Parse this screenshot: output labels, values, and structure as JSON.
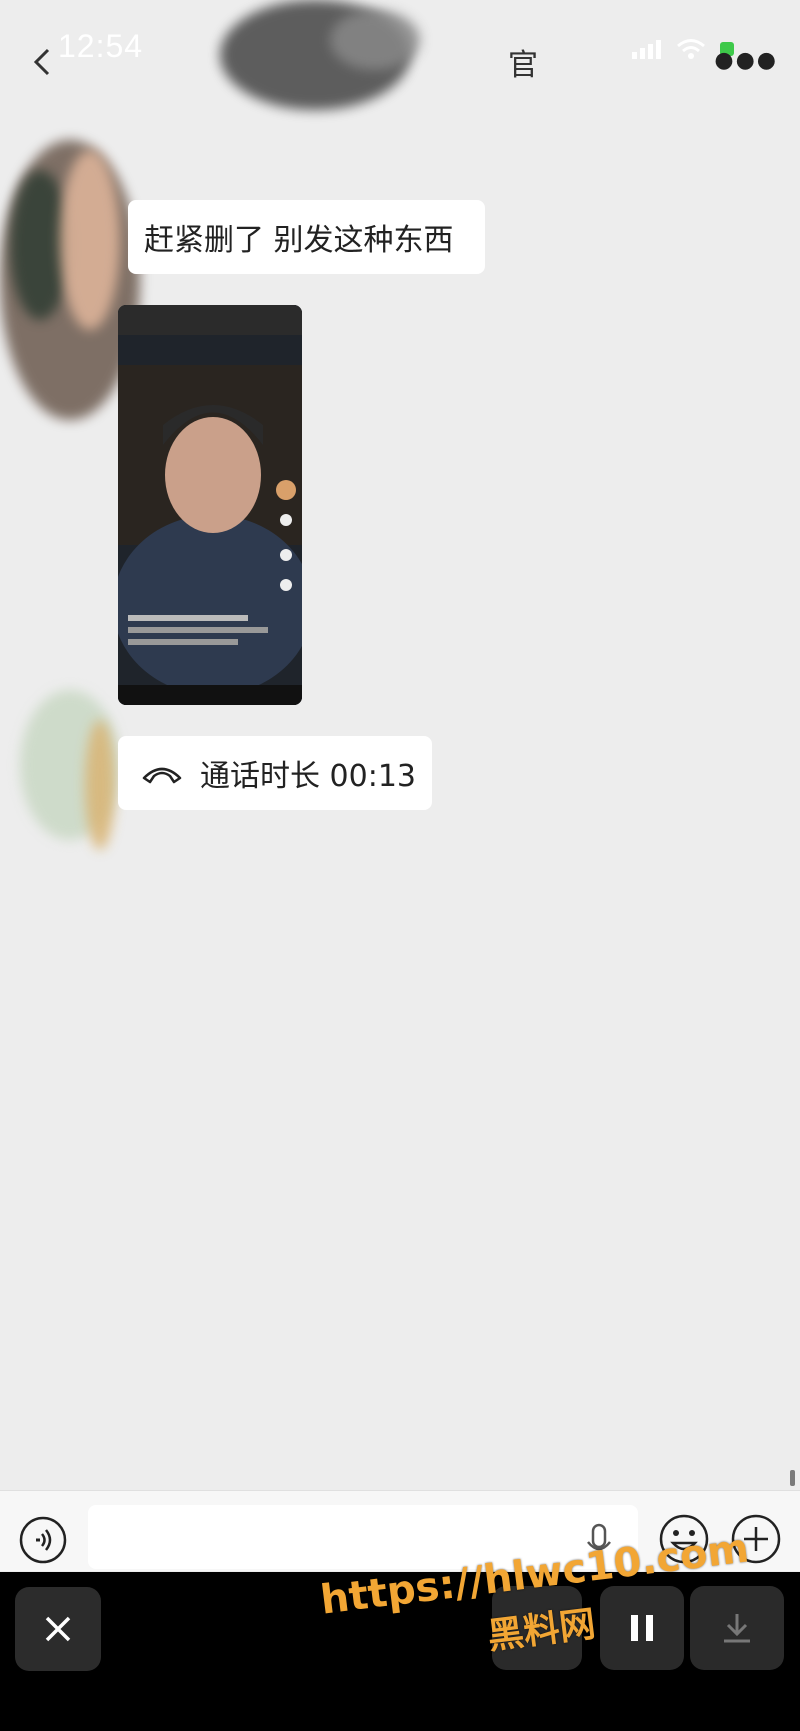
{
  "status_bar": {
    "time": "12:54"
  },
  "header": {
    "title": "官"
  },
  "messages": [
    {
      "type": "text",
      "text": "赶紧删了  别发这种东西"
    },
    {
      "type": "video"
    },
    {
      "type": "call",
      "text": "通话时长 00:13"
    }
  ],
  "input_bar": {
    "placeholder": ""
  },
  "watermark": {
    "url": "https://hlwc10.com",
    "name": "黑料网"
  },
  "colors": {
    "background": "#ededed",
    "bubble": "#ffffff",
    "watermark": "#f2a634",
    "bottom_bar": "#000000"
  },
  "icons": [
    "back-icon",
    "signal-icon",
    "wifi-icon",
    "battery-icon",
    "more-icon",
    "phone-hangup-icon",
    "voice-icon",
    "mic-icon",
    "emoji-icon",
    "plus-icon",
    "close-icon",
    "pause-icon",
    "download-icon"
  ]
}
